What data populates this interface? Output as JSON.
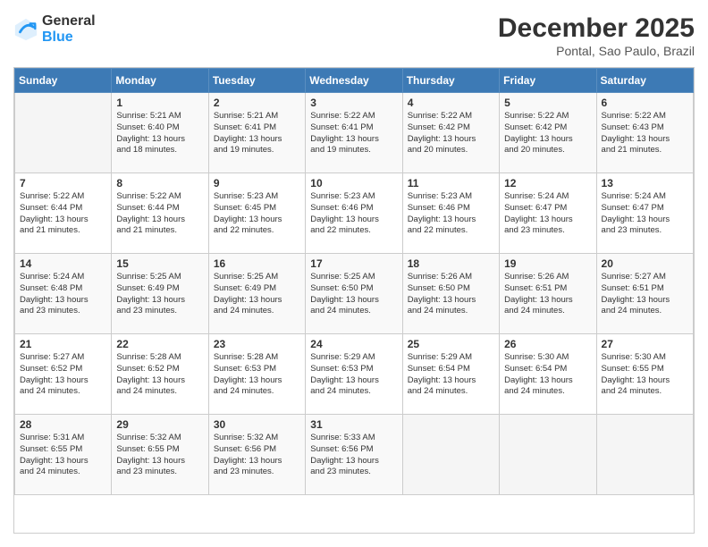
{
  "logo": {
    "line1": "General",
    "line2": "Blue"
  },
  "title": "December 2025",
  "subtitle": "Pontal, Sao Paulo, Brazil",
  "header_days": [
    "Sunday",
    "Monday",
    "Tuesday",
    "Wednesday",
    "Thursday",
    "Friday",
    "Saturday"
  ],
  "weeks": [
    [
      {
        "day": "",
        "info": ""
      },
      {
        "day": "1",
        "info": "Sunrise: 5:21 AM\nSunset: 6:40 PM\nDaylight: 13 hours\nand 18 minutes."
      },
      {
        "day": "2",
        "info": "Sunrise: 5:21 AM\nSunset: 6:41 PM\nDaylight: 13 hours\nand 19 minutes."
      },
      {
        "day": "3",
        "info": "Sunrise: 5:22 AM\nSunset: 6:41 PM\nDaylight: 13 hours\nand 19 minutes."
      },
      {
        "day": "4",
        "info": "Sunrise: 5:22 AM\nSunset: 6:42 PM\nDaylight: 13 hours\nand 20 minutes."
      },
      {
        "day": "5",
        "info": "Sunrise: 5:22 AM\nSunset: 6:42 PM\nDaylight: 13 hours\nand 20 minutes."
      },
      {
        "day": "6",
        "info": "Sunrise: 5:22 AM\nSunset: 6:43 PM\nDaylight: 13 hours\nand 21 minutes."
      }
    ],
    [
      {
        "day": "7",
        "info": "Sunrise: 5:22 AM\nSunset: 6:44 PM\nDaylight: 13 hours\nand 21 minutes."
      },
      {
        "day": "8",
        "info": "Sunrise: 5:22 AM\nSunset: 6:44 PM\nDaylight: 13 hours\nand 21 minutes."
      },
      {
        "day": "9",
        "info": "Sunrise: 5:23 AM\nSunset: 6:45 PM\nDaylight: 13 hours\nand 22 minutes."
      },
      {
        "day": "10",
        "info": "Sunrise: 5:23 AM\nSunset: 6:46 PM\nDaylight: 13 hours\nand 22 minutes."
      },
      {
        "day": "11",
        "info": "Sunrise: 5:23 AM\nSunset: 6:46 PM\nDaylight: 13 hours\nand 22 minutes."
      },
      {
        "day": "12",
        "info": "Sunrise: 5:24 AM\nSunset: 6:47 PM\nDaylight: 13 hours\nand 23 minutes."
      },
      {
        "day": "13",
        "info": "Sunrise: 5:24 AM\nSunset: 6:47 PM\nDaylight: 13 hours\nand 23 minutes."
      }
    ],
    [
      {
        "day": "14",
        "info": "Sunrise: 5:24 AM\nSunset: 6:48 PM\nDaylight: 13 hours\nand 23 minutes."
      },
      {
        "day": "15",
        "info": "Sunrise: 5:25 AM\nSunset: 6:49 PM\nDaylight: 13 hours\nand 23 minutes."
      },
      {
        "day": "16",
        "info": "Sunrise: 5:25 AM\nSunset: 6:49 PM\nDaylight: 13 hours\nand 24 minutes."
      },
      {
        "day": "17",
        "info": "Sunrise: 5:25 AM\nSunset: 6:50 PM\nDaylight: 13 hours\nand 24 minutes."
      },
      {
        "day": "18",
        "info": "Sunrise: 5:26 AM\nSunset: 6:50 PM\nDaylight: 13 hours\nand 24 minutes."
      },
      {
        "day": "19",
        "info": "Sunrise: 5:26 AM\nSunset: 6:51 PM\nDaylight: 13 hours\nand 24 minutes."
      },
      {
        "day": "20",
        "info": "Sunrise: 5:27 AM\nSunset: 6:51 PM\nDaylight: 13 hours\nand 24 minutes."
      }
    ],
    [
      {
        "day": "21",
        "info": "Sunrise: 5:27 AM\nSunset: 6:52 PM\nDaylight: 13 hours\nand 24 minutes."
      },
      {
        "day": "22",
        "info": "Sunrise: 5:28 AM\nSunset: 6:52 PM\nDaylight: 13 hours\nand 24 minutes."
      },
      {
        "day": "23",
        "info": "Sunrise: 5:28 AM\nSunset: 6:53 PM\nDaylight: 13 hours\nand 24 minutes."
      },
      {
        "day": "24",
        "info": "Sunrise: 5:29 AM\nSunset: 6:53 PM\nDaylight: 13 hours\nand 24 minutes."
      },
      {
        "day": "25",
        "info": "Sunrise: 5:29 AM\nSunset: 6:54 PM\nDaylight: 13 hours\nand 24 minutes."
      },
      {
        "day": "26",
        "info": "Sunrise: 5:30 AM\nSunset: 6:54 PM\nDaylight: 13 hours\nand 24 minutes."
      },
      {
        "day": "27",
        "info": "Sunrise: 5:30 AM\nSunset: 6:55 PM\nDaylight: 13 hours\nand 24 minutes."
      }
    ],
    [
      {
        "day": "28",
        "info": "Sunrise: 5:31 AM\nSunset: 6:55 PM\nDaylight: 13 hours\nand 24 minutes."
      },
      {
        "day": "29",
        "info": "Sunrise: 5:32 AM\nSunset: 6:55 PM\nDaylight: 13 hours\nand 23 minutes."
      },
      {
        "day": "30",
        "info": "Sunrise: 5:32 AM\nSunset: 6:56 PM\nDaylight: 13 hours\nand 23 minutes."
      },
      {
        "day": "31",
        "info": "Sunrise: 5:33 AM\nSunset: 6:56 PM\nDaylight: 13 hours\nand 23 minutes."
      },
      {
        "day": "",
        "info": ""
      },
      {
        "day": "",
        "info": ""
      },
      {
        "day": "",
        "info": ""
      }
    ]
  ]
}
